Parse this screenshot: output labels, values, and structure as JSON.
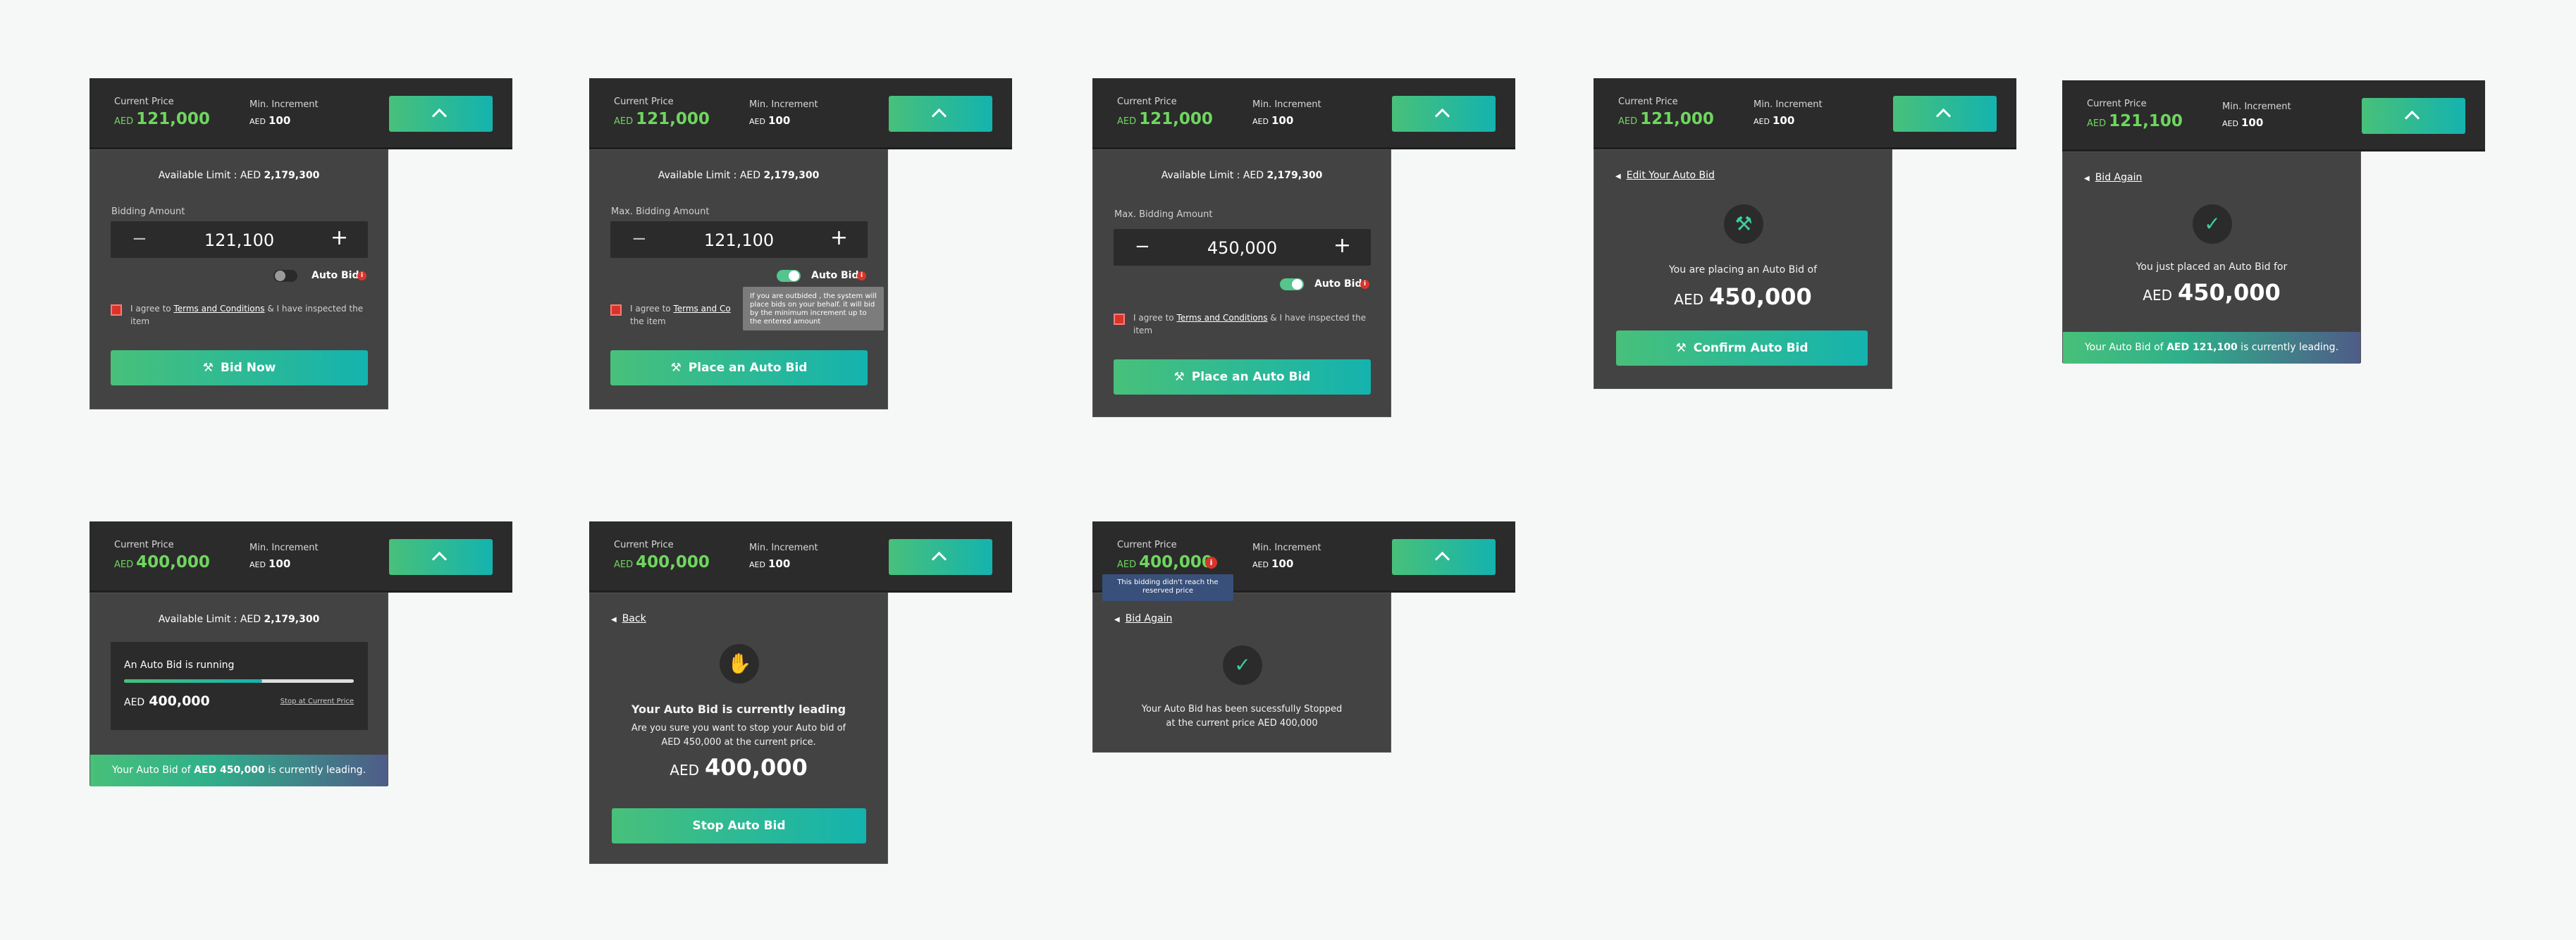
{
  "common": {
    "current_price_label": "Current Price",
    "min_increment_label": "Min. Increment",
    "currency": "AED",
    "min_increment_value": "100",
    "available_limit_prefix": "Available Limit : AED ",
    "available_limit_value": "2,179,300",
    "stepper_minus": "−",
    "stepper_plus": "+",
    "auto_bid_label": "Auto Bid",
    "info_glyph": "i",
    "agree_prefix": "I agree to ",
    "terms_link": "Terms and Conditions",
    "agree_suffix": " & I have inspected the item",
    "agree_suffix_short": " & I have inspected",
    "agree_line2": "the item",
    "leading_prefix": "Your Auto Bid of ",
    "leading_suffix": " is currently leading.",
    "accent_gradient": [
      "#48c07a",
      "#14b3ae"
    ],
    "error_color": "#d9342b"
  },
  "panels": {
    "p1": {
      "current_price": "121,000",
      "bidding_label": "Bidding Amount",
      "bid_value": "121,100",
      "auto_bid_on": false,
      "button_label": "Bid Now"
    },
    "p2": {
      "current_price": "121,000",
      "bidding_label": "Max. Bidding Amount",
      "bid_value": "121,100",
      "auto_bid_on": true,
      "tooltip": "If you are outbided , the system will place bids on your behalf. it will bid by the minimum increment up to the entered amount",
      "agree_partial": "I agree to ",
      "terms_partial": "Terms and Co",
      "button_label": "Place an Auto Bid"
    },
    "p3": {
      "current_price": "121,000",
      "bidding_label": "Max. Bidding Amount",
      "bid_value": "450,000",
      "auto_bid_on": true,
      "button_label": "Place an Auto Bid"
    },
    "p4": {
      "current_price": "121,000",
      "back_label": "Edit Your Auto Bid",
      "message": "You are placing an Auto Bid of",
      "amount": "450,000",
      "button_label": "Confirm Auto Bid"
    },
    "p5": {
      "current_price": "121,100",
      "back_label": "Bid Again",
      "message": "You just placed an Auto Bid for",
      "amount": "450,000",
      "leading_amount": "AED 121,100"
    },
    "p6": {
      "current_price": "400,000",
      "running_label": "An Auto Bid is running",
      "running_amount": "400,000",
      "stop_link": "Stop at Current Price",
      "progress": 0.6,
      "leading_amount": "AED 450,000"
    },
    "p7": {
      "current_price": "400,000",
      "back_label": "Back",
      "title": "Your Auto Bid is currently leading",
      "message_line1": "Are you sure you want to stop your Auto bid of",
      "message_line2": "AED 450,000 at the current price.",
      "amount": "400,000",
      "button_label": "Stop Auto Bid"
    },
    "p8": {
      "current_price": "400,000",
      "tooltip": "This bidding didn't reach the reserved price",
      "back_label": "Bid Again",
      "message_line1": "Your Auto Bid has been sucessfully Stopped",
      "message_line2": "at the current price AED 400,000"
    }
  }
}
